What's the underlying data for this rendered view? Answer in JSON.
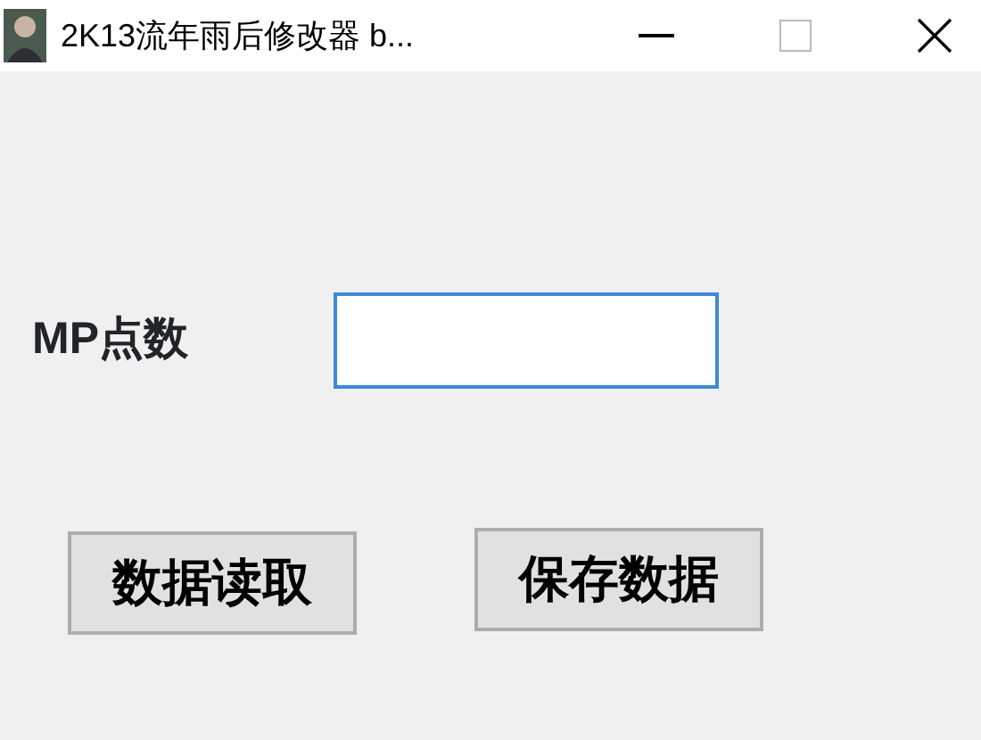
{
  "window": {
    "title": "2K13流年雨后修改器 b...",
    "focused": true
  },
  "field": {
    "label": "MP点数",
    "focused": true
  },
  "buttons": [
    "数据读取",
    "保存数据"
  ]
}
